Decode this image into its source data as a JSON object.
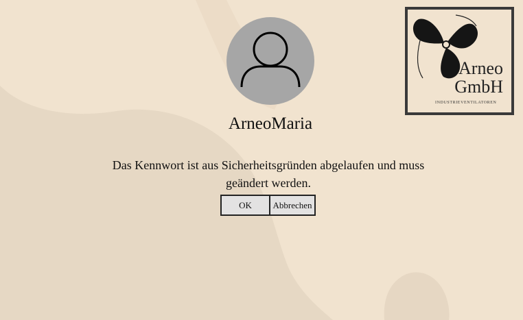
{
  "login": {
    "username": "ArneoMaria",
    "message": "Das Kennwort ist aus Sicherheitsgründen abgelaufen und muss geändert werden.",
    "ok_label": "OK",
    "cancel_label": "Abbrechen",
    "avatar_icon": "user-icon"
  },
  "logo": {
    "line1": "Arneo",
    "line2": "GmbH",
    "tagline": "INDUSTRIEVENTILATOREN",
    "icon": "fan-propeller-icon"
  },
  "colors": {
    "background": "#f1e3cf",
    "background_shape": "#e6d7c3",
    "avatar": "#a6a6a6",
    "button": "#e3e2e2",
    "button_border": "#222222"
  }
}
